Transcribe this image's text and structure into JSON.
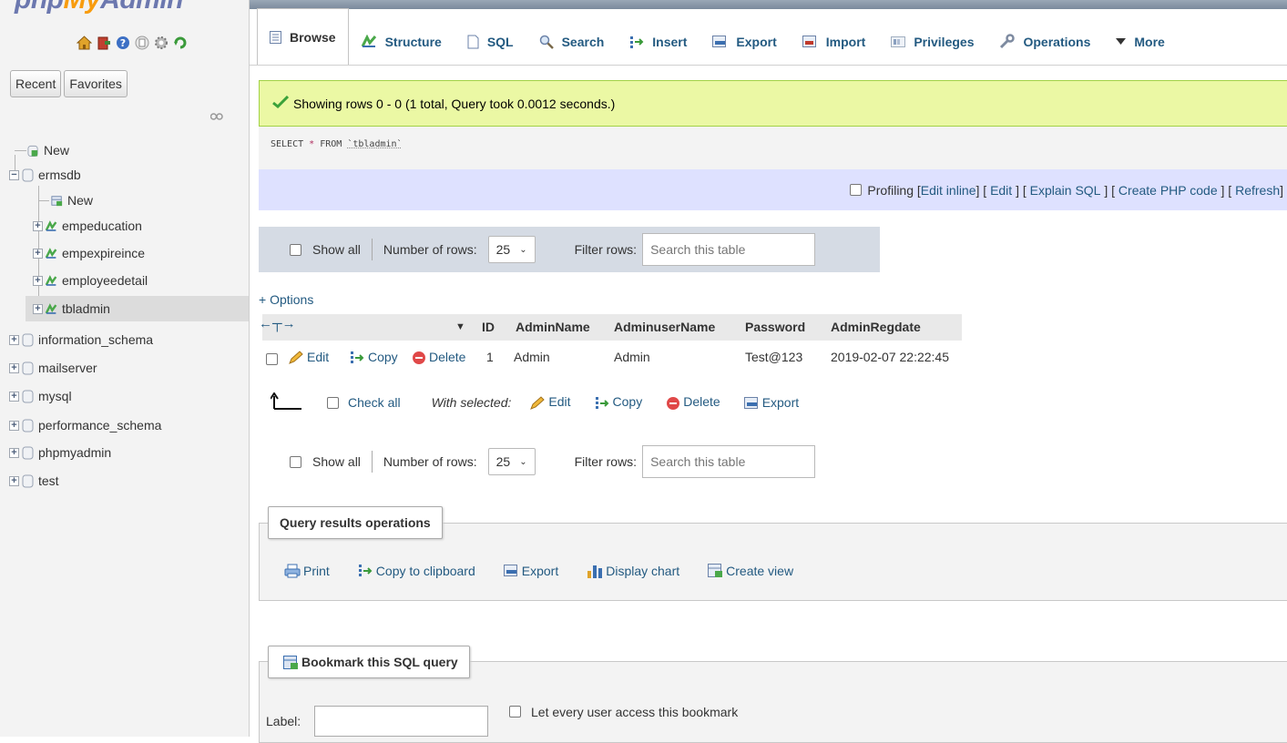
{
  "nav": {
    "logo": {
      "php": "php",
      "my": "My",
      "admin": "Admin"
    },
    "icons": [
      "home-icon",
      "logout-icon",
      "help-icon",
      "docs-icon",
      "settings-icon",
      "reload-icon"
    ],
    "recent_label": "Recent",
    "favorites_label": "Favorites",
    "tree": [
      {
        "label": "New",
        "kind": "new"
      },
      {
        "label": "ermsdb",
        "kind": "db-open"
      },
      {
        "label": "New",
        "kind": "new-child"
      },
      {
        "label": "empeducation",
        "kind": "table"
      },
      {
        "label": "empexpireince",
        "kind": "table"
      },
      {
        "label": "employeedetail",
        "kind": "table"
      },
      {
        "label": "tbladmin",
        "kind": "table-selected"
      },
      {
        "label": "information_schema",
        "kind": "db"
      },
      {
        "label": "mailserver",
        "kind": "db"
      },
      {
        "label": "mysql",
        "kind": "db"
      },
      {
        "label": "performance_schema",
        "kind": "db"
      },
      {
        "label": "phpmyadmin",
        "kind": "db"
      },
      {
        "label": "test",
        "kind": "db"
      }
    ]
  },
  "tabs": [
    "Browse",
    "Structure",
    "SQL",
    "Search",
    "Insert",
    "Export",
    "Import",
    "Privileges",
    "Operations",
    "More"
  ],
  "success_message": "Showing rows 0 - 0 (1 total, Query took 0.0012 seconds.)",
  "sql": {
    "kw1": "SELECT",
    "star": "*",
    "kw2": "FROM",
    "table": "`tbladmin`"
  },
  "profiling": {
    "label": "Profiling",
    "edit_inline": "Edit inline",
    "edit": "Edit",
    "explain": "Explain SQL",
    "create_php": "Create PHP code",
    "refresh": "Refresh"
  },
  "navbar": {
    "show_all": "Show all",
    "rows_label": "Number of rows:",
    "rows_value": "25",
    "filter_label": "Filter rows:",
    "filter_placeholder": "Search this table"
  },
  "options_label": "+ Options",
  "table": {
    "columns": [
      "ID",
      "AdminName",
      "AdminuserName",
      "Password",
      "AdminRegdate"
    ],
    "row_actions": {
      "edit": "Edit",
      "copy": "Copy",
      "delete": "Delete"
    },
    "rows": [
      {
        "ID": "1",
        "AdminName": "Admin",
        "AdminuserName": "Admin",
        "Password": "Test@123",
        "AdminRegdate": "2019-02-07 22:22:45"
      }
    ]
  },
  "bulk": {
    "check_all": "Check all",
    "with_selected": "With selected:",
    "edit": "Edit",
    "copy": "Copy",
    "delete": "Delete",
    "export": "Export"
  },
  "query_ops": {
    "legend": "Query results operations",
    "print": "Print",
    "copy_clipboard": "Copy to clipboard",
    "export": "Export",
    "display_chart": "Display chart",
    "create_view": "Create view"
  },
  "bookmark": {
    "legend": "Bookmark this SQL query",
    "label": "Label:",
    "share": "Let every user access this bookmark"
  }
}
